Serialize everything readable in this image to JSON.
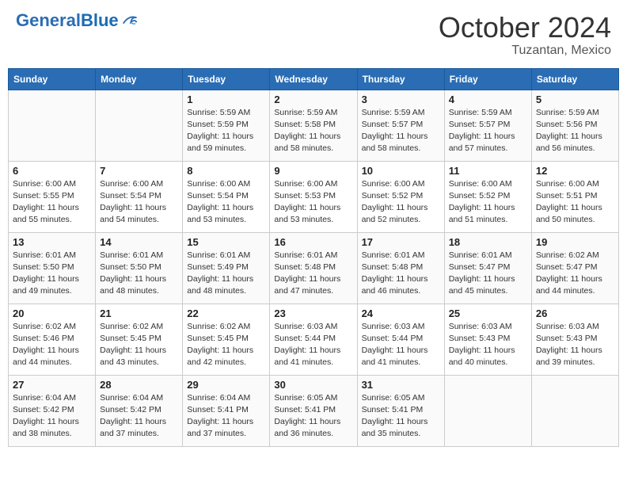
{
  "header": {
    "logo_general": "General",
    "logo_blue": "Blue",
    "month": "October 2024",
    "location": "Tuzantan, Mexico"
  },
  "days_of_week": [
    "Sunday",
    "Monday",
    "Tuesday",
    "Wednesday",
    "Thursday",
    "Friday",
    "Saturday"
  ],
  "weeks": [
    [
      {
        "day": "",
        "info": ""
      },
      {
        "day": "",
        "info": ""
      },
      {
        "day": "1",
        "info": "Sunrise: 5:59 AM\nSunset: 5:59 PM\nDaylight: 11 hours and 59 minutes."
      },
      {
        "day": "2",
        "info": "Sunrise: 5:59 AM\nSunset: 5:58 PM\nDaylight: 11 hours and 58 minutes."
      },
      {
        "day": "3",
        "info": "Sunrise: 5:59 AM\nSunset: 5:57 PM\nDaylight: 11 hours and 58 minutes."
      },
      {
        "day": "4",
        "info": "Sunrise: 5:59 AM\nSunset: 5:57 PM\nDaylight: 11 hours and 57 minutes."
      },
      {
        "day": "5",
        "info": "Sunrise: 5:59 AM\nSunset: 5:56 PM\nDaylight: 11 hours and 56 minutes."
      }
    ],
    [
      {
        "day": "6",
        "info": "Sunrise: 6:00 AM\nSunset: 5:55 PM\nDaylight: 11 hours and 55 minutes."
      },
      {
        "day": "7",
        "info": "Sunrise: 6:00 AM\nSunset: 5:54 PM\nDaylight: 11 hours and 54 minutes."
      },
      {
        "day": "8",
        "info": "Sunrise: 6:00 AM\nSunset: 5:54 PM\nDaylight: 11 hours and 53 minutes."
      },
      {
        "day": "9",
        "info": "Sunrise: 6:00 AM\nSunset: 5:53 PM\nDaylight: 11 hours and 53 minutes."
      },
      {
        "day": "10",
        "info": "Sunrise: 6:00 AM\nSunset: 5:52 PM\nDaylight: 11 hours and 52 minutes."
      },
      {
        "day": "11",
        "info": "Sunrise: 6:00 AM\nSunset: 5:52 PM\nDaylight: 11 hours and 51 minutes."
      },
      {
        "day": "12",
        "info": "Sunrise: 6:00 AM\nSunset: 5:51 PM\nDaylight: 11 hours and 50 minutes."
      }
    ],
    [
      {
        "day": "13",
        "info": "Sunrise: 6:01 AM\nSunset: 5:50 PM\nDaylight: 11 hours and 49 minutes."
      },
      {
        "day": "14",
        "info": "Sunrise: 6:01 AM\nSunset: 5:50 PM\nDaylight: 11 hours and 48 minutes."
      },
      {
        "day": "15",
        "info": "Sunrise: 6:01 AM\nSunset: 5:49 PM\nDaylight: 11 hours and 48 minutes."
      },
      {
        "day": "16",
        "info": "Sunrise: 6:01 AM\nSunset: 5:48 PM\nDaylight: 11 hours and 47 minutes."
      },
      {
        "day": "17",
        "info": "Sunrise: 6:01 AM\nSunset: 5:48 PM\nDaylight: 11 hours and 46 minutes."
      },
      {
        "day": "18",
        "info": "Sunrise: 6:01 AM\nSunset: 5:47 PM\nDaylight: 11 hours and 45 minutes."
      },
      {
        "day": "19",
        "info": "Sunrise: 6:02 AM\nSunset: 5:47 PM\nDaylight: 11 hours and 44 minutes."
      }
    ],
    [
      {
        "day": "20",
        "info": "Sunrise: 6:02 AM\nSunset: 5:46 PM\nDaylight: 11 hours and 44 minutes."
      },
      {
        "day": "21",
        "info": "Sunrise: 6:02 AM\nSunset: 5:45 PM\nDaylight: 11 hours and 43 minutes."
      },
      {
        "day": "22",
        "info": "Sunrise: 6:02 AM\nSunset: 5:45 PM\nDaylight: 11 hours and 42 minutes."
      },
      {
        "day": "23",
        "info": "Sunrise: 6:03 AM\nSunset: 5:44 PM\nDaylight: 11 hours and 41 minutes."
      },
      {
        "day": "24",
        "info": "Sunrise: 6:03 AM\nSunset: 5:44 PM\nDaylight: 11 hours and 41 minutes."
      },
      {
        "day": "25",
        "info": "Sunrise: 6:03 AM\nSunset: 5:43 PM\nDaylight: 11 hours and 40 minutes."
      },
      {
        "day": "26",
        "info": "Sunrise: 6:03 AM\nSunset: 5:43 PM\nDaylight: 11 hours and 39 minutes."
      }
    ],
    [
      {
        "day": "27",
        "info": "Sunrise: 6:04 AM\nSunset: 5:42 PM\nDaylight: 11 hours and 38 minutes."
      },
      {
        "day": "28",
        "info": "Sunrise: 6:04 AM\nSunset: 5:42 PM\nDaylight: 11 hours and 37 minutes."
      },
      {
        "day": "29",
        "info": "Sunrise: 6:04 AM\nSunset: 5:41 PM\nDaylight: 11 hours and 37 minutes."
      },
      {
        "day": "30",
        "info": "Sunrise: 6:05 AM\nSunset: 5:41 PM\nDaylight: 11 hours and 36 minutes."
      },
      {
        "day": "31",
        "info": "Sunrise: 6:05 AM\nSunset: 5:41 PM\nDaylight: 11 hours and 35 minutes."
      },
      {
        "day": "",
        "info": ""
      },
      {
        "day": "",
        "info": ""
      }
    ]
  ]
}
